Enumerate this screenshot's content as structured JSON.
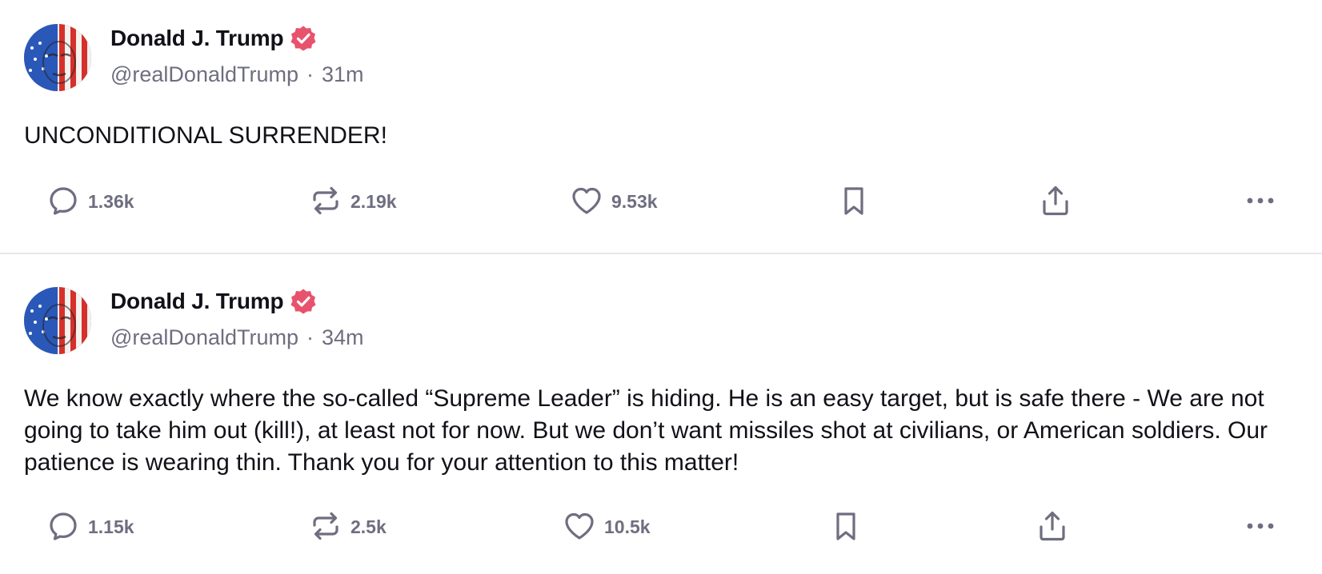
{
  "colors": {
    "verified_badge": "#e8526d",
    "icon_gray": "#6e6e80",
    "divider": "#e6e6ea"
  },
  "posts": [
    {
      "author": {
        "display_name": "Donald J. Trump",
        "handle": "@realDonaldTrump",
        "verified": true
      },
      "separator": "·",
      "time_ago": "31m",
      "text": "UNCONDITIONAL SURRENDER!",
      "stats": {
        "replies": "1.36k",
        "reposts": "2.19k",
        "likes": "9.53k"
      },
      "icons": [
        "reply-icon",
        "repost-icon",
        "heart-icon",
        "bookmark-icon",
        "share-icon",
        "more-icon"
      ]
    },
    {
      "author": {
        "display_name": "Donald J. Trump",
        "handle": "@realDonaldTrump",
        "verified": true
      },
      "separator": "·",
      "time_ago": "34m",
      "text": "We know exactly where the so-called “Supreme Leader” is hiding. He is an easy target, but is safe there - We are not going to take him out (kill!), at least not for now. But we don’t want missiles shot at civilians, or American soldiers. Our patience is wearing thin. Thank you for your attention to this matter!",
      "stats": {
        "replies": "1.15k",
        "reposts": "2.5k",
        "likes": "10.5k"
      },
      "icons": [
        "reply-icon",
        "repost-icon",
        "heart-icon",
        "bookmark-icon",
        "share-icon",
        "more-icon"
      ]
    }
  ]
}
